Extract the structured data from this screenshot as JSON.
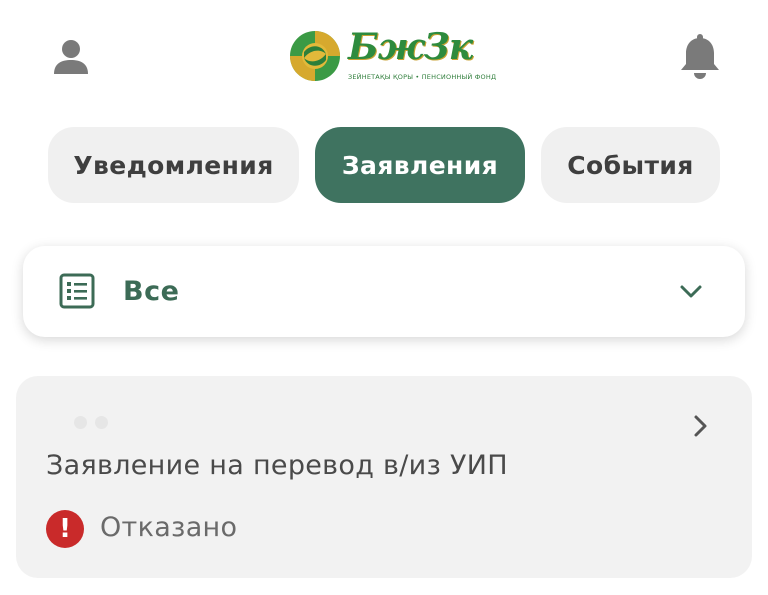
{
  "header": {
    "profile_icon": "user-icon",
    "notifications_icon": "bell-icon",
    "logo": {
      "wordmark": "БжЗк",
      "subtitle": "ЗЕЙНЕТАҚЫ ҚОРЫ • ПЕНСИОННЫЙ ФОНД"
    }
  },
  "tabs": [
    {
      "label": "Уведомления",
      "active": false
    },
    {
      "label": "Заявления",
      "active": true
    },
    {
      "label": "События",
      "active": false
    }
  ],
  "filter": {
    "icon": "list-icon",
    "selected": "Все",
    "chevron": "chevron-down-icon"
  },
  "applications": [
    {
      "title": "Заявление на перевод в/из УИП",
      "status": "Отказано",
      "status_icon": "exclamation-icon",
      "status_color": "#c92a2a"
    }
  ],
  "colors": {
    "accent": "#3f7360",
    "logo_green": "#2e8b3e",
    "logo_gold": "#c9a233",
    "error": "#c92a2a"
  }
}
